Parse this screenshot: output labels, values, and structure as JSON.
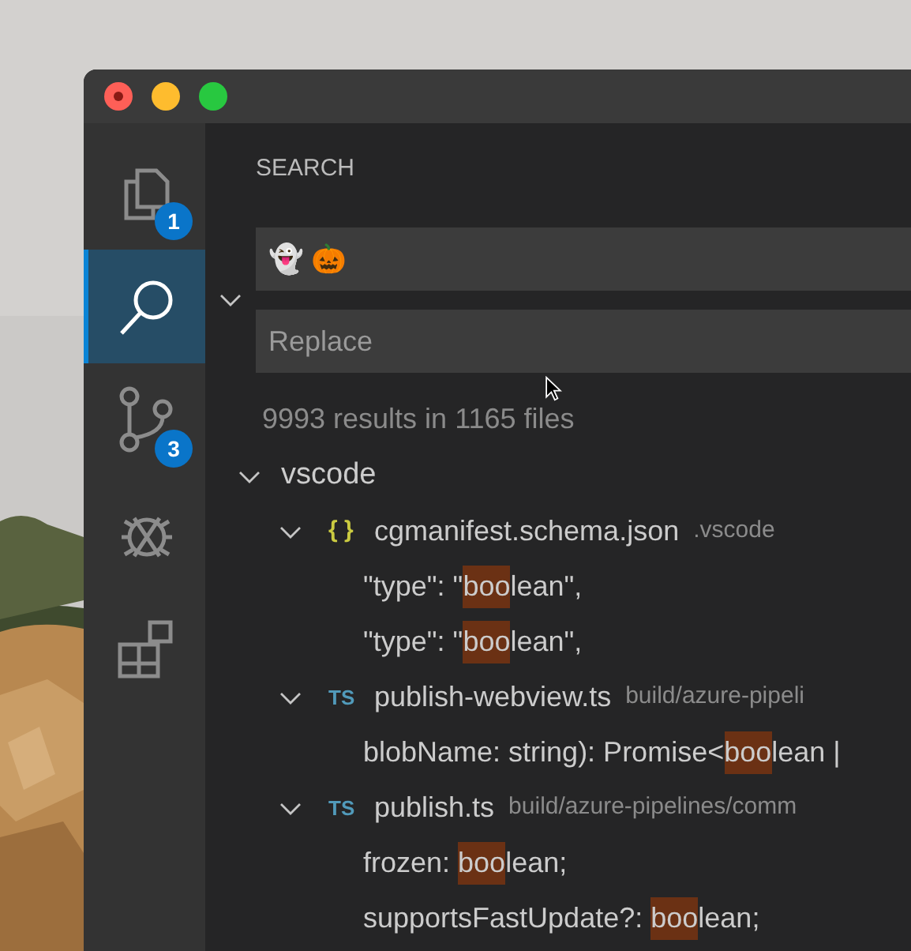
{
  "activity_bar": {
    "items": [
      {
        "kind": "files",
        "selected": false,
        "badge": "1"
      },
      {
        "kind": "search",
        "selected": true
      },
      {
        "kind": "source_control",
        "selected": false,
        "badge": "3"
      },
      {
        "kind": "debug",
        "selected": false
      },
      {
        "kind": "extensions",
        "selected": false
      }
    ]
  },
  "sidebar": {
    "title": "SEARCH",
    "replace_expanded": true,
    "search": {
      "value": "👻 🎃"
    },
    "replace": {
      "placeholder": "Replace"
    },
    "summary": "9993 results in 1165 files",
    "tree": [
      {
        "label": "vscode",
        "expanded": true,
        "children": [
          {
            "kind": "json",
            "icon": "{ }",
            "name": "cgmanifest.schema.json",
            "path": ".vscode",
            "expanded": true,
            "matches": [
              {
                "before": "\"type\": \"",
                "match": "boo",
                "after": "lean\","
              },
              {
                "before": "\"type\": \"",
                "match": "boo",
                "after": "lean\","
              }
            ]
          },
          {
            "kind": "ts",
            "icon": "TS",
            "name": "publish-webview.ts",
            "path": "build/azure-pipeli",
            "expanded": true,
            "matches": [
              {
                "before": "blobName: string): Promise<",
                "match": "boo",
                "after": "lean |"
              }
            ]
          },
          {
            "kind": "ts",
            "icon": "TS",
            "name": "publish.ts",
            "path": "build/azure-pipelines/comm",
            "expanded": true,
            "matches": [
              {
                "before": "frozen: ",
                "match": "boo",
                "after": "lean;"
              },
              {
                "before": "supportsFastUpdate?: ",
                "match": "boo",
                "after": "lean;"
              }
            ]
          }
        ]
      }
    ]
  }
}
